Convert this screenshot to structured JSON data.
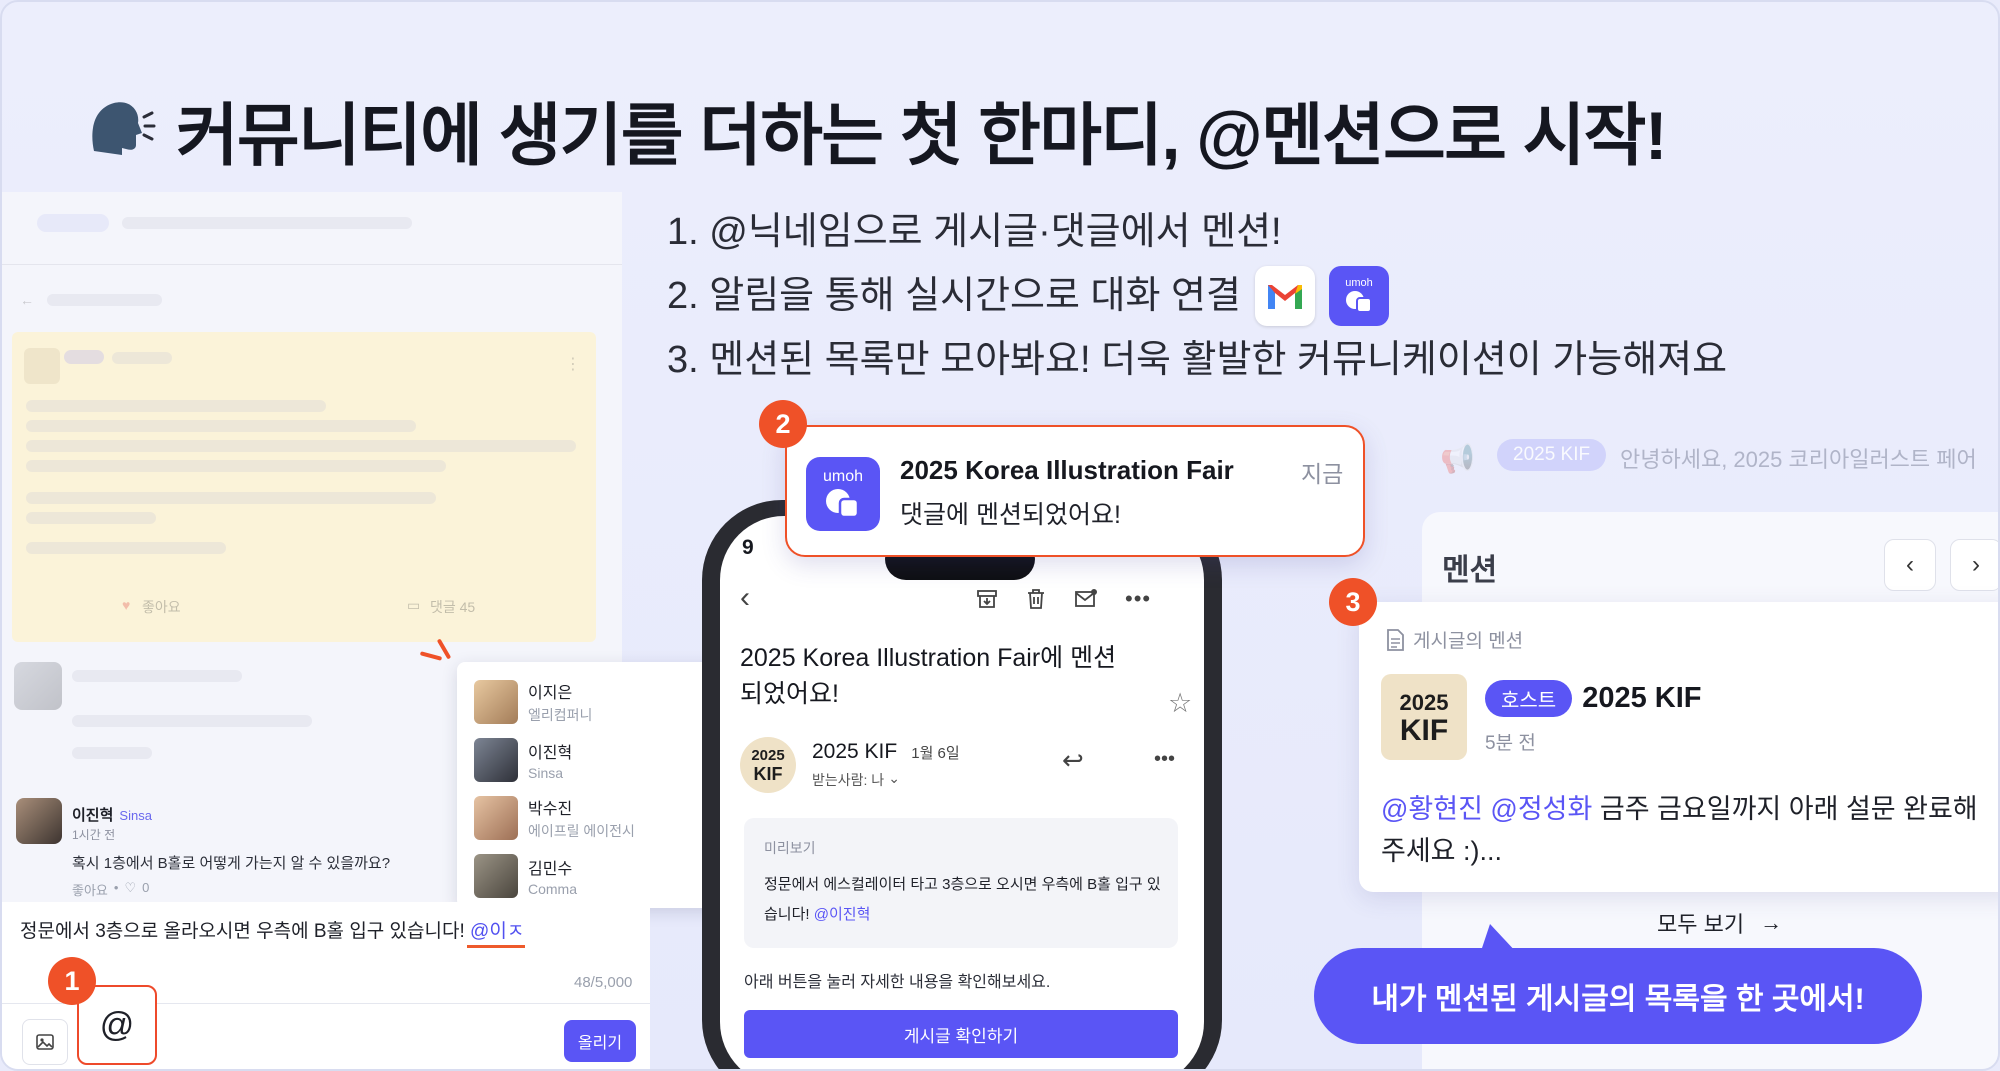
{
  "headline": {
    "title": "커뮤니티에 생기를 더하는 첫 한마디, @멘션으로 시작!",
    "emoji_icon": "speaking-head-icon"
  },
  "features": [
    "1. @닉네임으로 게시글·댓글에서 멘션!",
    "2. 알림을 통해 실시간으로 대화 연결",
    "3. 멘션된 목록만 모아봐요! 더욱 활발한 커뮤니케이션이 가능해져요"
  ],
  "feature_icons": [
    "gmail-icon",
    "umoh-app-icon"
  ],
  "colors": {
    "accent": "#5a55f5",
    "highlight": "#ef5128",
    "background": "#e9ebfb"
  },
  "badges": [
    "1",
    "2",
    "3"
  ],
  "left_panel": {
    "post_card": {
      "likes_label": "좋아요",
      "comments_label": "댓글 45"
    },
    "comments": [
      {
        "name": "이진혁",
        "tag": "Sinsa",
        "time": "1시간 전",
        "text": "혹시 1층에서 B홀로 어떻게 가는지 알 수 있을까요?",
        "like_label": "좋아요",
        "heart_count": "0"
      }
    ],
    "mention_suggestions": [
      {
        "name": "이지은",
        "sub": "엘리컴퍼니"
      },
      {
        "name": "이진혁",
        "sub": "Sinsa"
      },
      {
        "name": "박수진",
        "sub": "에이프릴 에이전시"
      },
      {
        "name": "김민수",
        "sub": "Comma"
      }
    ],
    "composer": {
      "text": "정문에서 3층으로 올라오시면 우측에 B홀 입구 있습니다!",
      "typing_mention": "@이ㅈ",
      "counter": "48/5,000",
      "at_symbol": "@",
      "post_button": "올리기"
    }
  },
  "notification": {
    "app_name": "umoh",
    "title": "2025 Korea Illustration Fair",
    "body": "댓글에 멘션되었어요!",
    "time": "지금"
  },
  "email": {
    "status_time": "9",
    "subject": "2025 Korea Illustration Fair에 멘션되었어요!",
    "sender_logo_line1": "2025",
    "sender_logo_line2": "KIF",
    "sender": "2025 KIF",
    "date": "1월 6일",
    "recipient": "받는사람: 나",
    "preview_label": "미리보기",
    "preview_text": "정문에서 에스컬레이터 타고 3층으로 오시면 우측에 B홀 입구 있습니다!",
    "preview_mention": "@이진혁",
    "instruction": "아래 버튼을 눌러 자세한 내용을 확인해보세요.",
    "cta_button": "게시글 확인하기"
  },
  "right_panel": {
    "announcement_badge": "2025 KIF",
    "announcement_text": "안녕하세요, 2025 코리아일러스트 페어 ",
    "section_title": "멘션",
    "card": {
      "label": "게시글의 멘션",
      "logo_line1": "2025",
      "logo_line2": "KIF",
      "host_badge": "호스트",
      "author": "2025 KIF",
      "time": "5분 전",
      "mentions": "@황현진 @정성화",
      "text_a": "금주 금요일까지 아래 설문 완료해",
      "text_b": "주세요 :)..."
    },
    "see_all": "모두 보기"
  },
  "callout": "내가 멘션된 게시글의 목록을 한 곳에서!"
}
